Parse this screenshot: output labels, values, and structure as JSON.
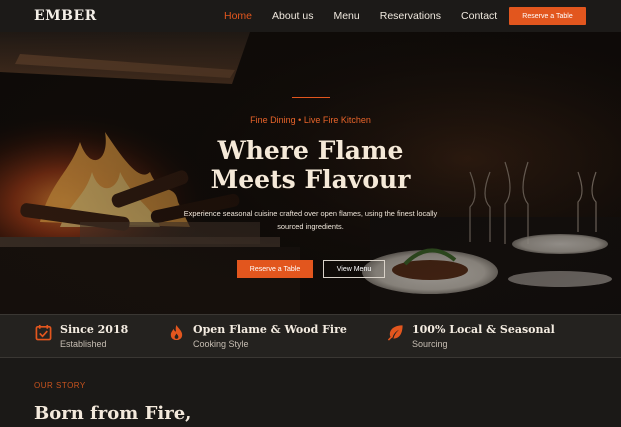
{
  "brand": "EMBER",
  "nav": {
    "links": [
      "Home",
      "About us",
      "Menu",
      "Reservations",
      "Contact"
    ],
    "active": "Home",
    "cta": "Reserve a Table"
  },
  "hero": {
    "eyebrow": "Fine Dining • Live Fire Kitchen",
    "title_line1": "Where Flame",
    "title_line2": "Meets Flavour",
    "subtitle": "Experience seasonal cuisine crafted over open flames, using the finest locally sourced ingredients.",
    "primary_button": "Reserve a Table",
    "secondary_button": "View Menu"
  },
  "features": [
    {
      "icon": "calendar-check-icon",
      "title": "Since 2018",
      "sub": "Established"
    },
    {
      "icon": "flame-icon",
      "title": "Open Flame & Wood Fire",
      "sub": "Cooking Style"
    },
    {
      "icon": "leaf-icon",
      "title": "100% Local & Seasonal",
      "sub": "Sourcing"
    }
  ],
  "story": {
    "eyebrow": "OUR STORY",
    "title": "Born from Fire,"
  },
  "colors": {
    "accent": "#e2561e",
    "background": "#1a1816",
    "cream": "#f5e9d8"
  }
}
